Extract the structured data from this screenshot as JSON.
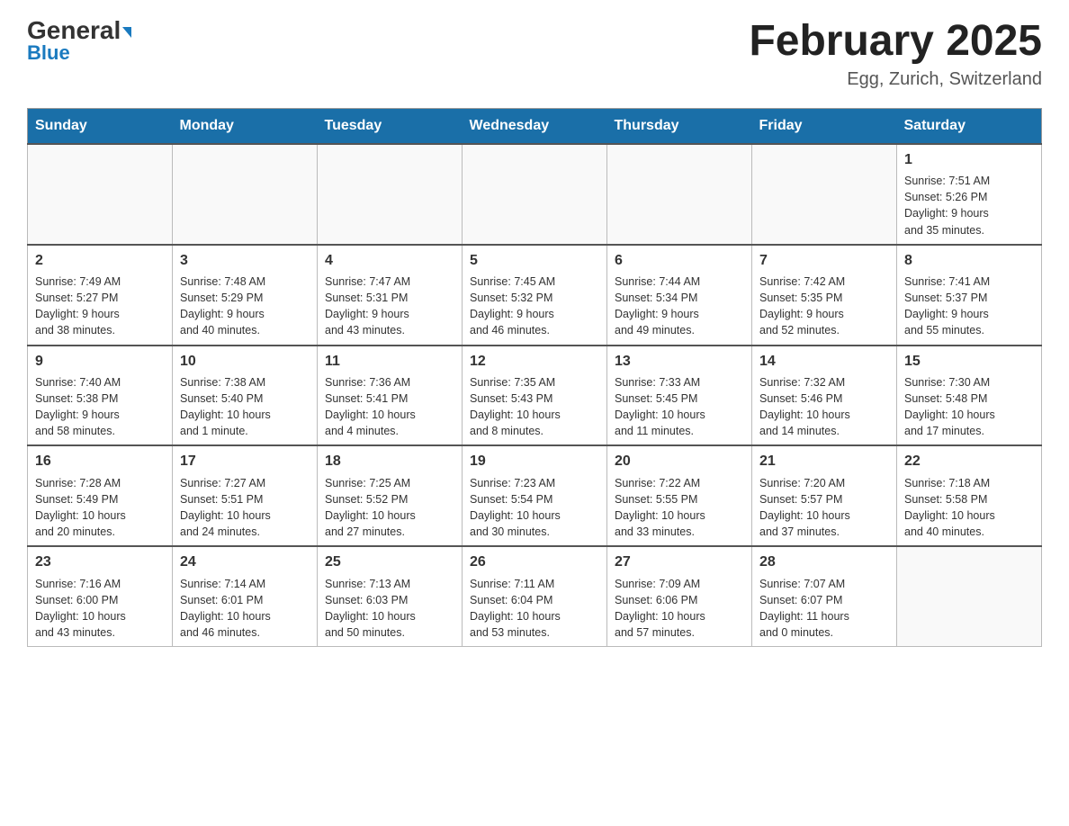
{
  "header": {
    "logo_general": "General",
    "logo_blue": "Blue",
    "month_title": "February 2025",
    "location": "Egg, Zurich, Switzerland"
  },
  "days_of_week": [
    "Sunday",
    "Monday",
    "Tuesday",
    "Wednesday",
    "Thursday",
    "Friday",
    "Saturday"
  ],
  "weeks": [
    [
      {
        "day": "",
        "info": ""
      },
      {
        "day": "",
        "info": ""
      },
      {
        "day": "",
        "info": ""
      },
      {
        "day": "",
        "info": ""
      },
      {
        "day": "",
        "info": ""
      },
      {
        "day": "",
        "info": ""
      },
      {
        "day": "1",
        "info": "Sunrise: 7:51 AM\nSunset: 5:26 PM\nDaylight: 9 hours\nand 35 minutes."
      }
    ],
    [
      {
        "day": "2",
        "info": "Sunrise: 7:49 AM\nSunset: 5:27 PM\nDaylight: 9 hours\nand 38 minutes."
      },
      {
        "day": "3",
        "info": "Sunrise: 7:48 AM\nSunset: 5:29 PM\nDaylight: 9 hours\nand 40 minutes."
      },
      {
        "day": "4",
        "info": "Sunrise: 7:47 AM\nSunset: 5:31 PM\nDaylight: 9 hours\nand 43 minutes."
      },
      {
        "day": "5",
        "info": "Sunrise: 7:45 AM\nSunset: 5:32 PM\nDaylight: 9 hours\nand 46 minutes."
      },
      {
        "day": "6",
        "info": "Sunrise: 7:44 AM\nSunset: 5:34 PM\nDaylight: 9 hours\nand 49 minutes."
      },
      {
        "day": "7",
        "info": "Sunrise: 7:42 AM\nSunset: 5:35 PM\nDaylight: 9 hours\nand 52 minutes."
      },
      {
        "day": "8",
        "info": "Sunrise: 7:41 AM\nSunset: 5:37 PM\nDaylight: 9 hours\nand 55 minutes."
      }
    ],
    [
      {
        "day": "9",
        "info": "Sunrise: 7:40 AM\nSunset: 5:38 PM\nDaylight: 9 hours\nand 58 minutes."
      },
      {
        "day": "10",
        "info": "Sunrise: 7:38 AM\nSunset: 5:40 PM\nDaylight: 10 hours\nand 1 minute."
      },
      {
        "day": "11",
        "info": "Sunrise: 7:36 AM\nSunset: 5:41 PM\nDaylight: 10 hours\nand 4 minutes."
      },
      {
        "day": "12",
        "info": "Sunrise: 7:35 AM\nSunset: 5:43 PM\nDaylight: 10 hours\nand 8 minutes."
      },
      {
        "day": "13",
        "info": "Sunrise: 7:33 AM\nSunset: 5:45 PM\nDaylight: 10 hours\nand 11 minutes."
      },
      {
        "day": "14",
        "info": "Sunrise: 7:32 AM\nSunset: 5:46 PM\nDaylight: 10 hours\nand 14 minutes."
      },
      {
        "day": "15",
        "info": "Sunrise: 7:30 AM\nSunset: 5:48 PM\nDaylight: 10 hours\nand 17 minutes."
      }
    ],
    [
      {
        "day": "16",
        "info": "Sunrise: 7:28 AM\nSunset: 5:49 PM\nDaylight: 10 hours\nand 20 minutes."
      },
      {
        "day": "17",
        "info": "Sunrise: 7:27 AM\nSunset: 5:51 PM\nDaylight: 10 hours\nand 24 minutes."
      },
      {
        "day": "18",
        "info": "Sunrise: 7:25 AM\nSunset: 5:52 PM\nDaylight: 10 hours\nand 27 minutes."
      },
      {
        "day": "19",
        "info": "Sunrise: 7:23 AM\nSunset: 5:54 PM\nDaylight: 10 hours\nand 30 minutes."
      },
      {
        "day": "20",
        "info": "Sunrise: 7:22 AM\nSunset: 5:55 PM\nDaylight: 10 hours\nand 33 minutes."
      },
      {
        "day": "21",
        "info": "Sunrise: 7:20 AM\nSunset: 5:57 PM\nDaylight: 10 hours\nand 37 minutes."
      },
      {
        "day": "22",
        "info": "Sunrise: 7:18 AM\nSunset: 5:58 PM\nDaylight: 10 hours\nand 40 minutes."
      }
    ],
    [
      {
        "day": "23",
        "info": "Sunrise: 7:16 AM\nSunset: 6:00 PM\nDaylight: 10 hours\nand 43 minutes."
      },
      {
        "day": "24",
        "info": "Sunrise: 7:14 AM\nSunset: 6:01 PM\nDaylight: 10 hours\nand 46 minutes."
      },
      {
        "day": "25",
        "info": "Sunrise: 7:13 AM\nSunset: 6:03 PM\nDaylight: 10 hours\nand 50 minutes."
      },
      {
        "day": "26",
        "info": "Sunrise: 7:11 AM\nSunset: 6:04 PM\nDaylight: 10 hours\nand 53 minutes."
      },
      {
        "day": "27",
        "info": "Sunrise: 7:09 AM\nSunset: 6:06 PM\nDaylight: 10 hours\nand 57 minutes."
      },
      {
        "day": "28",
        "info": "Sunrise: 7:07 AM\nSunset: 6:07 PM\nDaylight: 11 hours\nand 0 minutes."
      },
      {
        "day": "",
        "info": ""
      }
    ]
  ]
}
